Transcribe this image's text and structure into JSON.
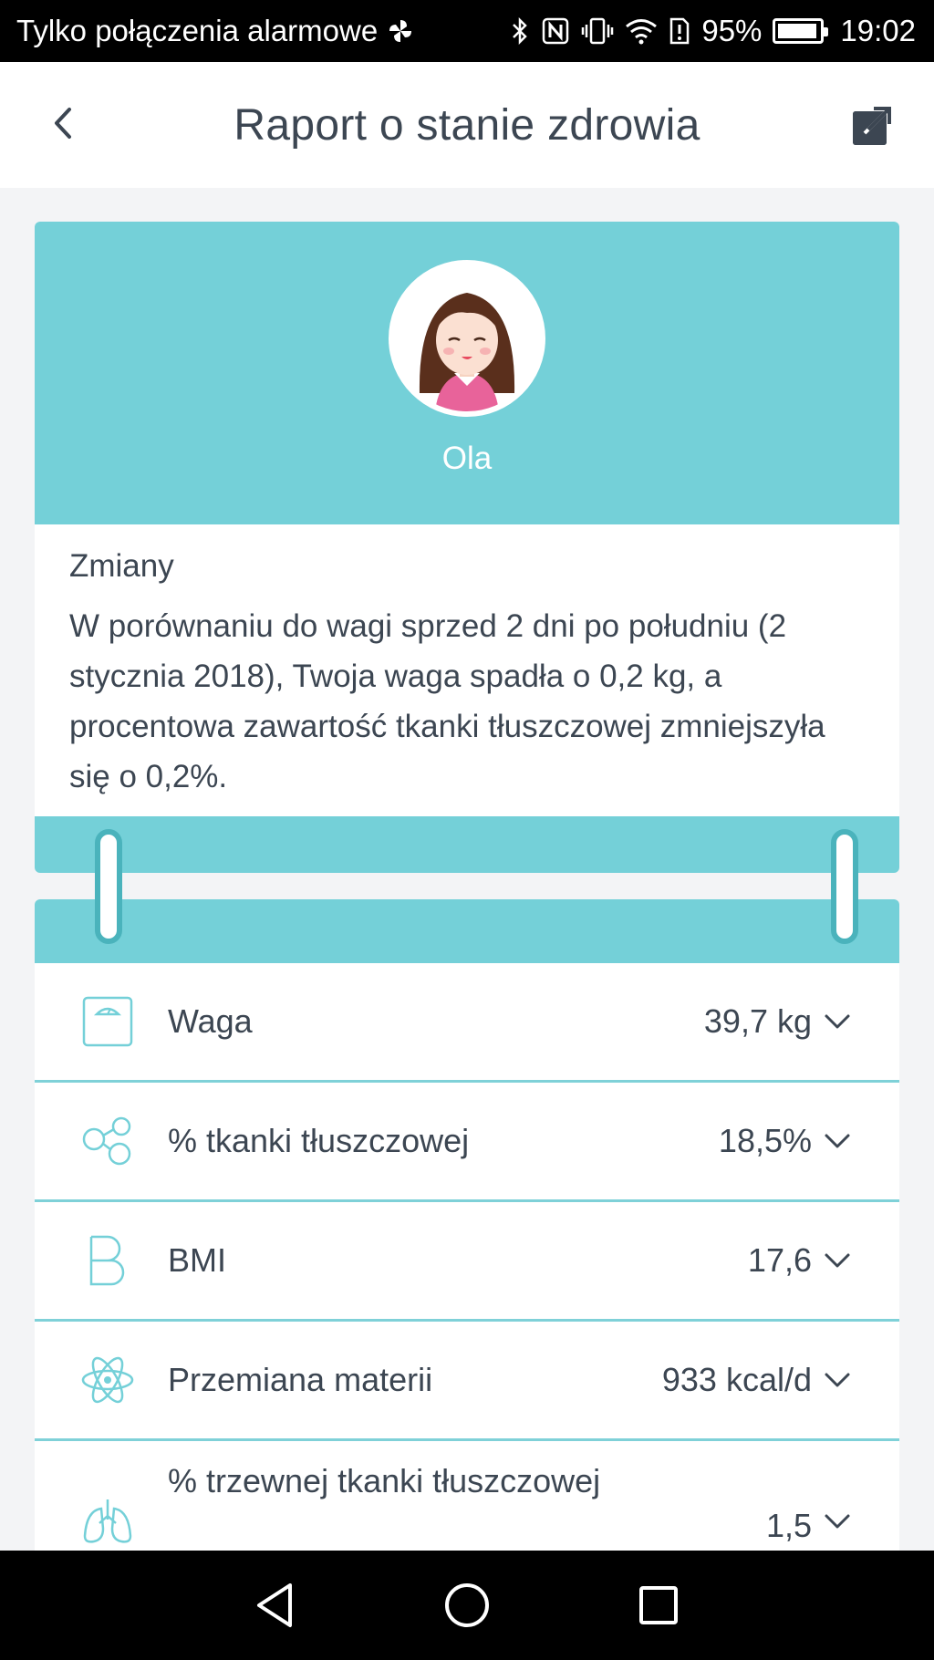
{
  "status_bar": {
    "carrier": "Tylko połączenia alarmowe",
    "battery": "95%",
    "time": "19:02"
  },
  "app_bar": {
    "title": "Raport o stanie zdrowia"
  },
  "profile": {
    "name": "Ola"
  },
  "changes": {
    "title": "Zmiany",
    "text": "W porównaniu do wagi sprzed 2 dni po południu (2 stycznia 2018), Twoja waga spadła o 0,2 kg, a procentowa zawartość tkanki tłuszczowej zmniejszyła się o 0,2%."
  },
  "metrics": [
    {
      "label": "Waga",
      "value": "39,7 kg",
      "icon": "scale-icon"
    },
    {
      "label": "% tkanki tłuszczowej",
      "value": "18,5%",
      "icon": "bubbles-icon"
    },
    {
      "label": "BMI",
      "value": "17,6",
      "icon": "bmi-letter-icon"
    },
    {
      "label": "Przemiana materii",
      "value": "933 kcal/d",
      "icon": "atom-icon"
    },
    {
      "label": "% trzewnej tkanki tłuszczowej",
      "value": "1,5",
      "icon": "lungs-icon"
    }
  ],
  "colors": {
    "accent": "#74d0d8",
    "divider": "#7fd1d8",
    "text": "#3c4652",
    "background": "#f3f4f6"
  }
}
